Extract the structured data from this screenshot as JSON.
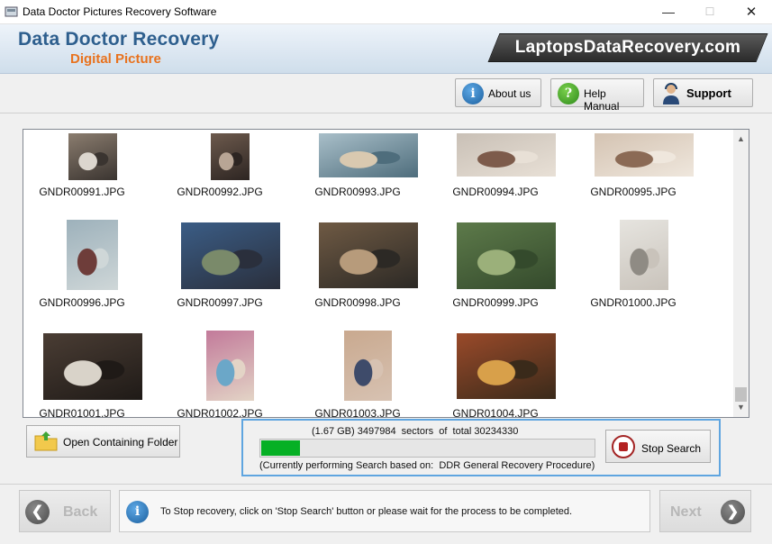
{
  "window": {
    "title": "Data Doctor Pictures Recovery Software",
    "minimize": "—",
    "maximize": "☐",
    "close": "✕"
  },
  "header": {
    "brand_title": "Data Doctor Recovery",
    "brand_subtitle": "Digital Picture",
    "site": "LaptopsDataRecovery.com"
  },
  "toolbar": {
    "about": "About us",
    "help": "Help Manual",
    "support": "Support"
  },
  "gallery": {
    "files": [
      {
        "name": "GNDR00991.JPG",
        "colors": [
          "#8b7d6f",
          "#dcd6ce",
          "#3a3430"
        ]
      },
      {
        "name": "GNDR00992.JPG",
        "colors": [
          "#6d5a4d",
          "#b8a595",
          "#2d2522"
        ]
      },
      {
        "name": "GNDR00993.JPG",
        "colors": [
          "#a9bfc9",
          "#d9c9b0",
          "#4e6d7c"
        ]
      },
      {
        "name": "GNDR00994.JPG",
        "colors": [
          "#c9c0b6",
          "#7d5b4b",
          "#e8e0d6"
        ]
      },
      {
        "name": "GNDR00995.JPG",
        "colors": [
          "#d4c3b2",
          "#8b6a55",
          "#efe7dd"
        ]
      },
      {
        "name": "GNDR00996.JPG",
        "colors": [
          "#9db1bb",
          "#6e3d3a",
          "#cfd7d8"
        ]
      },
      {
        "name": "GNDR00997.JPG",
        "colors": [
          "#3b5d86",
          "#7a8a6a",
          "#2a2f3c"
        ]
      },
      {
        "name": "GNDR00998.JPG",
        "colors": [
          "#6f5a44",
          "#b79b7b",
          "#2c2925"
        ]
      },
      {
        "name": "GNDR00999.JPG",
        "colors": [
          "#5d7a4a",
          "#9bb07a",
          "#344a2c"
        ]
      },
      {
        "name": "GNDR01000.JPG",
        "colors": [
          "#e6e4df",
          "#8f8b84",
          "#c9c3bb"
        ]
      },
      {
        "name": "GNDR01001.JPG",
        "colors": [
          "#4a3d34",
          "#d9d3c9",
          "#1f1a17"
        ]
      },
      {
        "name": "GNDR01002.JPG",
        "colors": [
          "#c27a9a",
          "#6ba7c8",
          "#e3d4c6"
        ]
      },
      {
        "name": "GNDR01003.JPG",
        "colors": [
          "#c9a98f",
          "#3e4b6a",
          "#d7c2b2"
        ]
      },
      {
        "name": "GNDR01004.JPG",
        "colors": [
          "#9a4a2a",
          "#d8a04a",
          "#3a2a1a"
        ]
      }
    ]
  },
  "open_folder": {
    "label": "Open Containing Folder"
  },
  "status": {
    "sectors_text": "(1.67 GB) 3497984  sectors  of  total 30234330",
    "progress_fraction": 0.1157,
    "current_text": "(Currently performing Search based on:  DDR General Recovery Procedure)",
    "stop_label": "Stop Search"
  },
  "footer": {
    "back": "Back",
    "next": "Next",
    "info": "To Stop recovery, click on 'Stop Search' button or please wait for the process to be completed."
  }
}
